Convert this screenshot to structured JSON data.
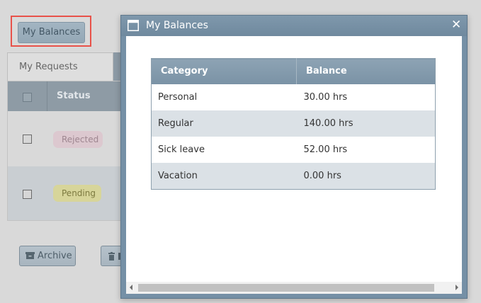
{
  "page": {
    "balances_button": "My Balances",
    "tabs": [
      {
        "label": "My Requests"
      }
    ],
    "grid": {
      "columns": [
        "Status"
      ],
      "rows": [
        {
          "status": "Rejected"
        },
        {
          "status": "Pending"
        }
      ]
    },
    "actions": {
      "archive_label": "Archive"
    }
  },
  "modal": {
    "title": "My Balances",
    "close_glyph": "✕",
    "table": {
      "headers": [
        "Category",
        "Balance"
      ],
      "rows": [
        {
          "category": "Personal",
          "balance": "30.00 hrs"
        },
        {
          "category": "Regular",
          "balance": "140.00 hrs"
        },
        {
          "category": "Sick leave",
          "balance": "52.00 hrs"
        },
        {
          "category": "Vacation",
          "balance": "0.00 hrs"
        }
      ]
    }
  },
  "colors": {
    "highlight": "#e8524a",
    "modal_frame": "#7590a6",
    "table_header": "#7a92a5",
    "rejected_badge": "#dcc8cf",
    "pending_badge": "#d7d59a"
  }
}
